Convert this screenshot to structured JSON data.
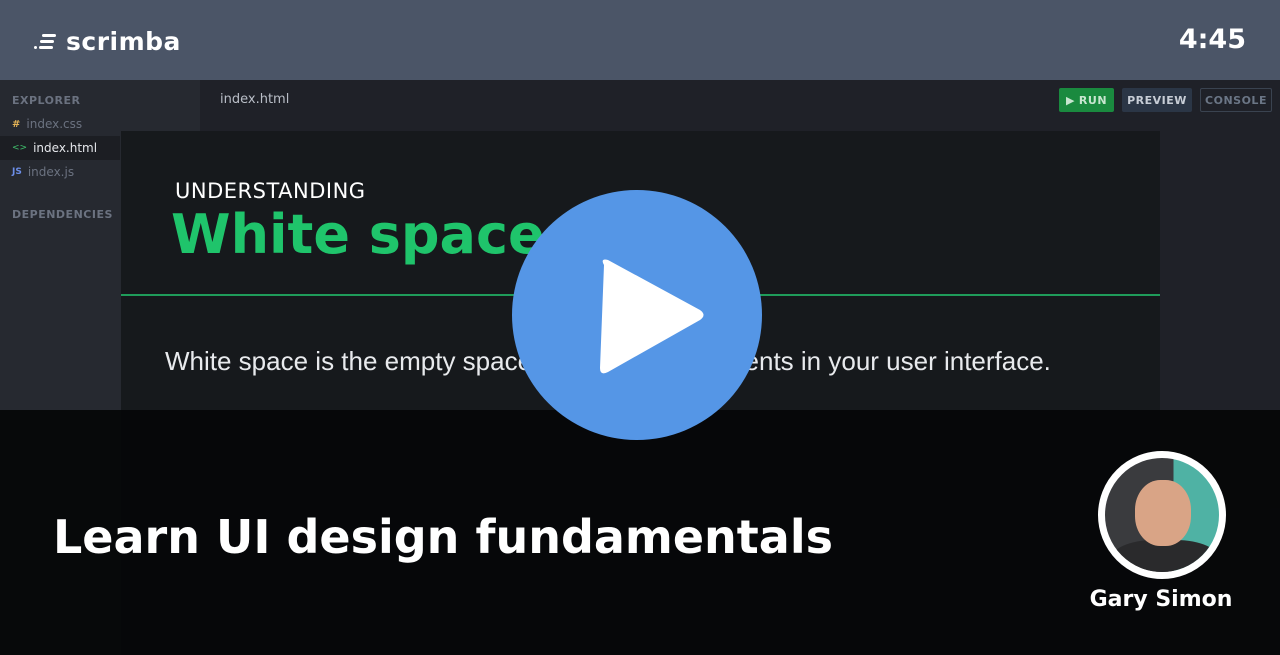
{
  "header": {
    "logo_text": "scrimba",
    "timer": "4:45"
  },
  "sidebar": {
    "explorer_label": "EXPLORER",
    "files": [
      {
        "icon": "#",
        "name": "index.css",
        "color": "#e2b256"
      },
      {
        "icon": "<>",
        "name": "index.html",
        "color": "#3fbf6b"
      },
      {
        "icon": "JS",
        "name": "index.js",
        "color": "#6c8ee8"
      }
    ],
    "dependencies_label": "DEPENDENCIES"
  },
  "editor": {
    "active_tab": "index.html",
    "run_label": "RUN",
    "preview_label": "PREVIEW",
    "console_label": "CONSOLE"
  },
  "preview": {
    "subtitle": "UNDERSTANDING",
    "title": "White space",
    "paragraph": "White space is the empty space between the elements in your user interface."
  },
  "overlay": {
    "course_title": "Learn UI design fundamentals",
    "instructor": "Gary Simon"
  },
  "colors": {
    "accent_green": "#1fc46b",
    "play_blue": "#5596e6",
    "header_bg": "#4b5567"
  }
}
